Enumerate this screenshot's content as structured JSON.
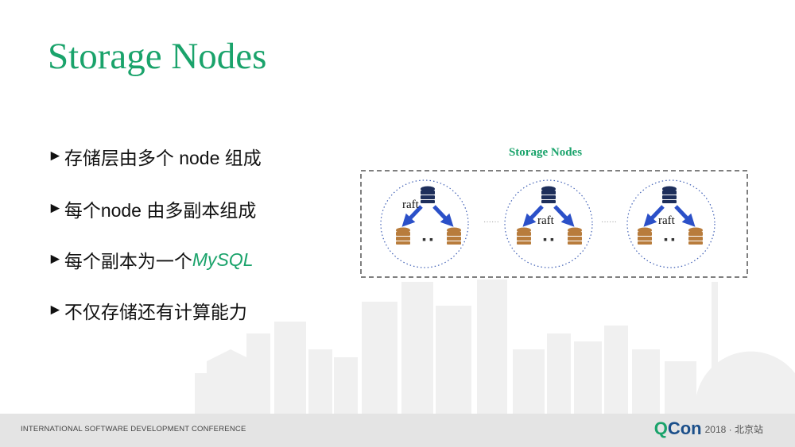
{
  "slide": {
    "title": "Storage Nodes",
    "bullet_marker": "►",
    "bullets": [
      {
        "text": "存储层由多个 node 组成"
      },
      {
        "text": "每个node 由多副本组成"
      },
      {
        "text": "每个副本为一个 ",
        "accent": "MySQL"
      },
      {
        "text": "不仅存储还有计算能力"
      }
    ]
  },
  "diagram": {
    "title": "Storage Nodes",
    "node_label": "raft",
    "ellipsis": "······",
    "node_count": 3
  },
  "footer": {
    "conference": "INTERNATIONAL SOFTWARE DEVELOPMENT CONFERENCE",
    "brand_q": "Q",
    "brand_con": "Con",
    "event": "2018 · 北京站"
  },
  "colors": {
    "accent_green": "#1aa36b",
    "arrow_blue": "#2b50c8",
    "db_navy": "#1e2f5b",
    "db_orange": "#b87c3c"
  }
}
